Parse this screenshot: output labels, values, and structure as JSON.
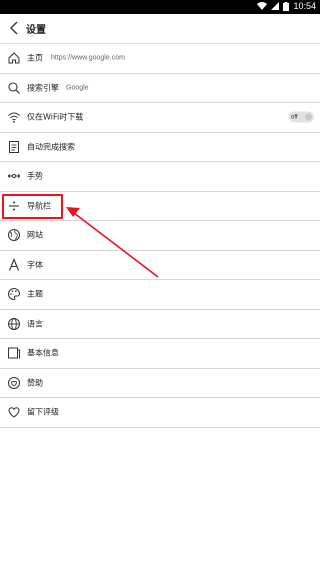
{
  "status_bar": {
    "time": "10:54"
  },
  "app_bar": {
    "title": "设置"
  },
  "settings": [
    {
      "label": "主页",
      "value": "https://www.google.com",
      "icon": "home-icon"
    },
    {
      "label": "搜索引擎",
      "value": "Google",
      "icon": "search-icon"
    },
    {
      "label": "仅在WiFi时下载",
      "toggle": "off",
      "icon": "wifi-icon"
    },
    {
      "label": "自动完成搜索",
      "icon": "document-icon"
    },
    {
      "label": "手势",
      "icon": "gesture-icon"
    },
    {
      "label": "导航栏",
      "icon": "divide-icon"
    },
    {
      "label": "网站",
      "icon": "globe-icon"
    },
    {
      "label": "字体",
      "icon": "font-icon"
    },
    {
      "label": "主题",
      "icon": "palette-icon"
    },
    {
      "label": "语言",
      "icon": "language-icon"
    },
    {
      "label": "基本信息",
      "icon": "info-icon"
    },
    {
      "label": "赞助",
      "icon": "sponsor-icon"
    },
    {
      "label": "留下评级",
      "icon": "heart-icon"
    }
  ],
  "annotation": {
    "highlight_color": "#e8141e"
  }
}
